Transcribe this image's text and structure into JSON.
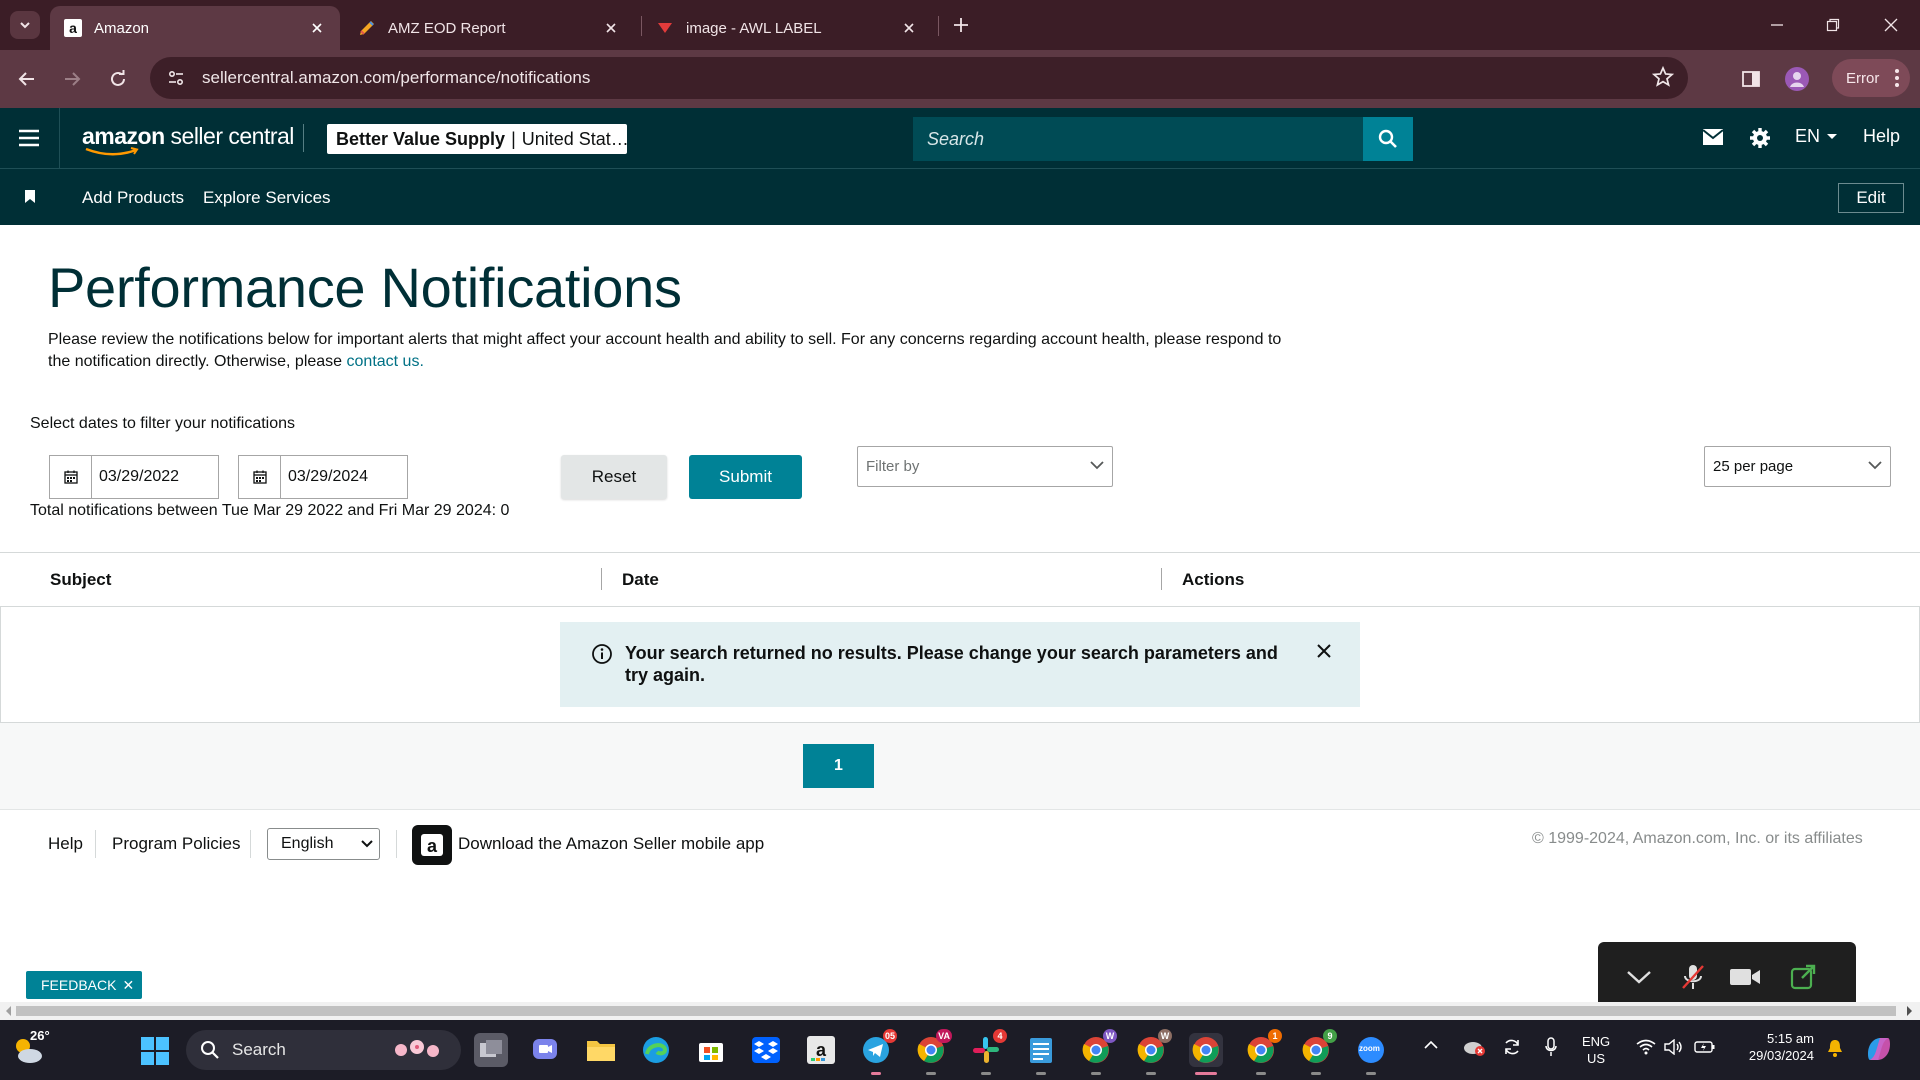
{
  "browser": {
    "tabs": [
      {
        "title": "Amazon",
        "active": true
      },
      {
        "title": "AMZ EOD Report",
        "active": false
      },
      {
        "title": "image - AWL LABEL",
        "active": false
      }
    ],
    "url": "sellercentral.amazon.com/performance/notifications",
    "profile_status": "Error"
  },
  "header": {
    "logo_brand": "amazon",
    "logo_product": "seller central",
    "store_name": "Better Value Supply",
    "store_region": "United Stat…",
    "search_placeholder": "Search",
    "language": "EN",
    "help": "Help"
  },
  "subnav": {
    "links": [
      "Add Products",
      "Explore Services"
    ],
    "edit": "Edit"
  },
  "page": {
    "title": "Performance Notifications",
    "intro_text": "Please review the notifications below for important alerts that might affect your account health and ability to sell. For any concerns regarding account health, please respond to the notification directly. Otherwise, please ",
    "intro_link": "contact us.",
    "filter_label": "Select dates to filter your notifications",
    "start_date": "03/29/2022",
    "end_date": "03/29/2024",
    "total_text": "Total notifications between Tue Mar 29 2022 and Fri Mar 29 2024: 0",
    "reset_label": "Reset",
    "submit_label": "Submit",
    "filter_placeholder": "Filter by",
    "per_page": "25 per page"
  },
  "table": {
    "columns": [
      "Subject",
      "Date",
      "Actions"
    ],
    "empty_message": "Your search returned no results. Please change your search parameters and try again."
  },
  "pagination": {
    "current_page": "1"
  },
  "footer": {
    "help": "Help",
    "program_policies": "Program Policies",
    "language_selected": "English",
    "app_link": "Download the Amazon Seller mobile app",
    "copyright": "© 1999-2024, Amazon.com, Inc. or its affiliates"
  },
  "feedback": {
    "label": "FEEDBACK"
  },
  "taskbar": {
    "weather_temp": "26°",
    "search_label": "Search",
    "badges": {
      "telegram": "05",
      "chrome_va": "VA",
      "slack": "4",
      "chrome_w1": "W",
      "chrome_w2": "W",
      "chrome_1": "1",
      "chrome_9": "9"
    },
    "zoom_label": "zoom",
    "lang_line1": "ENG",
    "lang_line2": "US",
    "time": "5:15 am",
    "date": "29/03/2024"
  },
  "colors": {
    "tabbar_bg": "#3b1d26",
    "toolbar_bg": "#5d3944",
    "sc_header_bg": "#002f36",
    "accent_teal": "#008296",
    "alert_bg": "#e3f0f2"
  }
}
